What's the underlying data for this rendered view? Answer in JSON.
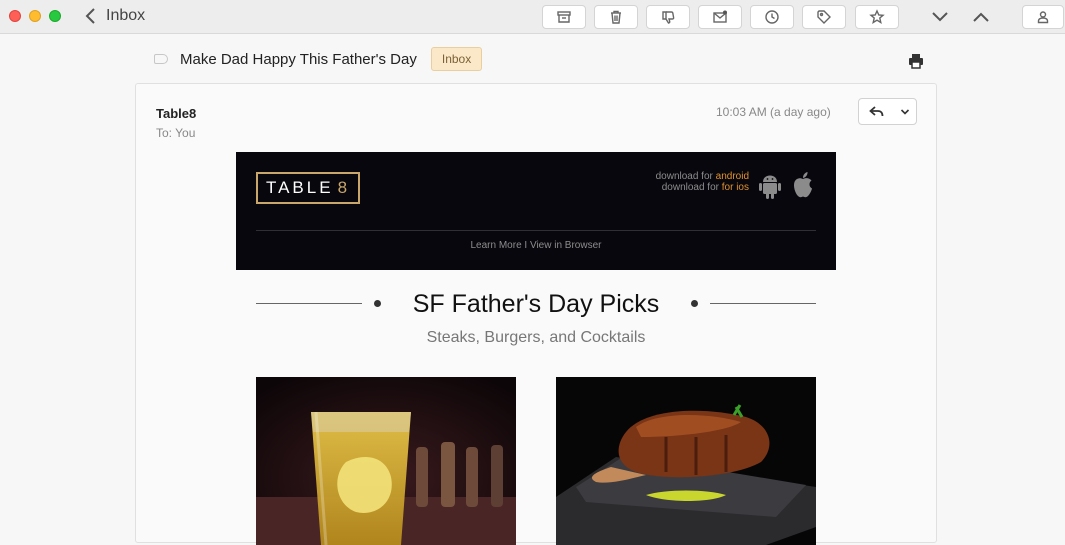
{
  "toolbar": {
    "back_label": "Inbox",
    "buttons": [
      "archive-icon",
      "trash-icon",
      "thumbs-down-icon",
      "mail-unread-icon",
      "clock-icon",
      "tag-icon",
      "star-icon"
    ],
    "nav": [
      "chevron-down-icon",
      "chevron-up-icon"
    ],
    "account": "person-icon"
  },
  "message": {
    "subject": "Make Dad Happy This Father's Day",
    "folder_badge": "Inbox",
    "sender": "Table8",
    "to": "To: You",
    "time": "10:03 AM (a day ago)"
  },
  "email": {
    "logo_text": "TABLE",
    "logo_number": "8",
    "download_prefix": "download for",
    "android_link": "android",
    "ios_link": "for ios",
    "banner_links": "Learn More I View in Browser",
    "heading": "SF Father's Day Picks",
    "subheading": "Steaks, Burgers, and Cocktails"
  },
  "colors": {
    "accent_gold": "#c9a76b",
    "link_orange": "#e0922f",
    "banner_bg": "#08070d",
    "badge_bg": "#fbe8c8"
  }
}
